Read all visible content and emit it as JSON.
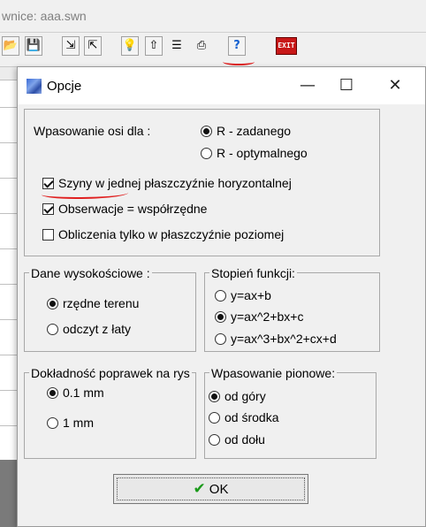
{
  "background_window": {
    "title_fragment": "wnice: aaa.swn",
    "toolbar_icons": [
      "open-folder-icon",
      "save-icon",
      "import-icon",
      "export-icon",
      "lightbulb-icon",
      "upload-icon",
      "document-icon",
      "print-icon",
      "help-icon",
      "exit-icon"
    ],
    "exit_label": "EXIT"
  },
  "dialog": {
    "title": "Opcje",
    "window_buttons": {
      "minimize": "—",
      "maximize": "☐",
      "close": "✕"
    },
    "fit_axis": {
      "label": "Wpasowanie osi dla :",
      "options": [
        {
          "label": "R - zadanego",
          "selected": true
        },
        {
          "label": "R - optymalnego",
          "selected": false
        }
      ]
    },
    "checkboxes": [
      {
        "label": "Szyny w jednej płaszczyźnie horyzontalnej",
        "checked": true
      },
      {
        "label": "Obserwacje = współrzędne",
        "checked": true
      },
      {
        "label": "Obliczenia tylko w płaszczyźnie poziomej",
        "checked": false
      }
    ],
    "height_data": {
      "legend": "Dane wysokościowe :",
      "options": [
        {
          "label": "rzędne terenu",
          "selected": true
        },
        {
          "label": "odczyt z łaty",
          "selected": false
        }
      ]
    },
    "function_degree": {
      "legend": "Stopień funkcji:",
      "options": [
        {
          "label": "y=ax+b",
          "selected": false
        },
        {
          "label": "y=ax^2+bx+c",
          "selected": true
        },
        {
          "label": "y=ax^3+bx^2+cx+d",
          "selected": false
        }
      ]
    },
    "correction_accuracy": {
      "legend": "Dokładność poprawek na rys",
      "options": [
        {
          "label": "0.1 mm",
          "selected": true
        },
        {
          "label": "1 mm",
          "selected": false
        }
      ]
    },
    "vertical_fit": {
      "legend": "Wpasowanie pionowe:",
      "options": [
        {
          "label": "od góry",
          "selected": true
        },
        {
          "label": "od środka",
          "selected": false
        },
        {
          "label": "od dołu",
          "selected": false
        }
      ]
    },
    "ok_label": "OK"
  },
  "colors": {
    "annotation_red": "#e02020",
    "ok_check_green": "#1a9a1a"
  }
}
